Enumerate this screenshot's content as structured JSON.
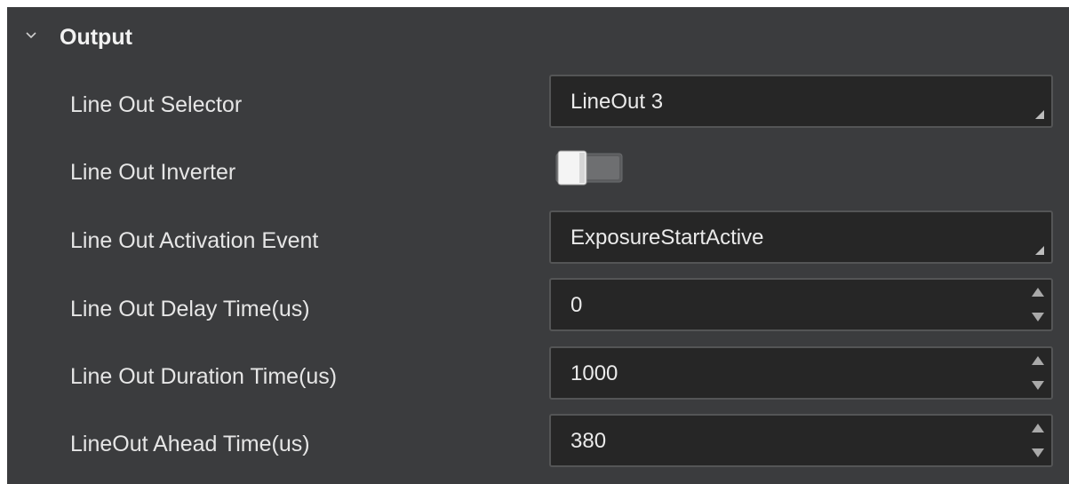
{
  "section": {
    "title": "Output",
    "expand_icon": "chevron-down-icon"
  },
  "rows": {
    "line_out_selector": {
      "label": "Line Out Selector",
      "value": "LineOut 3",
      "control": "dropdown"
    },
    "line_out_inverter": {
      "label": "Line Out Inverter",
      "value": "off",
      "control": "toggle"
    },
    "line_out_activation_event": {
      "label": "Line Out Activation Event",
      "value": "ExposureStartActive",
      "control": "dropdown"
    },
    "line_out_delay_time": {
      "label": "Line Out Delay Time(us)",
      "value": "0",
      "control": "spinbox"
    },
    "line_out_duration_time": {
      "label": "Line Out Duration Time(us)",
      "value": "1000",
      "control": "spinbox"
    },
    "lineout_ahead_time": {
      "label": "LineOut Ahead Time(us)",
      "value": "380",
      "control": "spinbox"
    }
  },
  "colors": {
    "panel_bg": "#3b3c3e",
    "field_bg": "#262626",
    "field_border": "#545556",
    "text": "#e6e6e6"
  }
}
